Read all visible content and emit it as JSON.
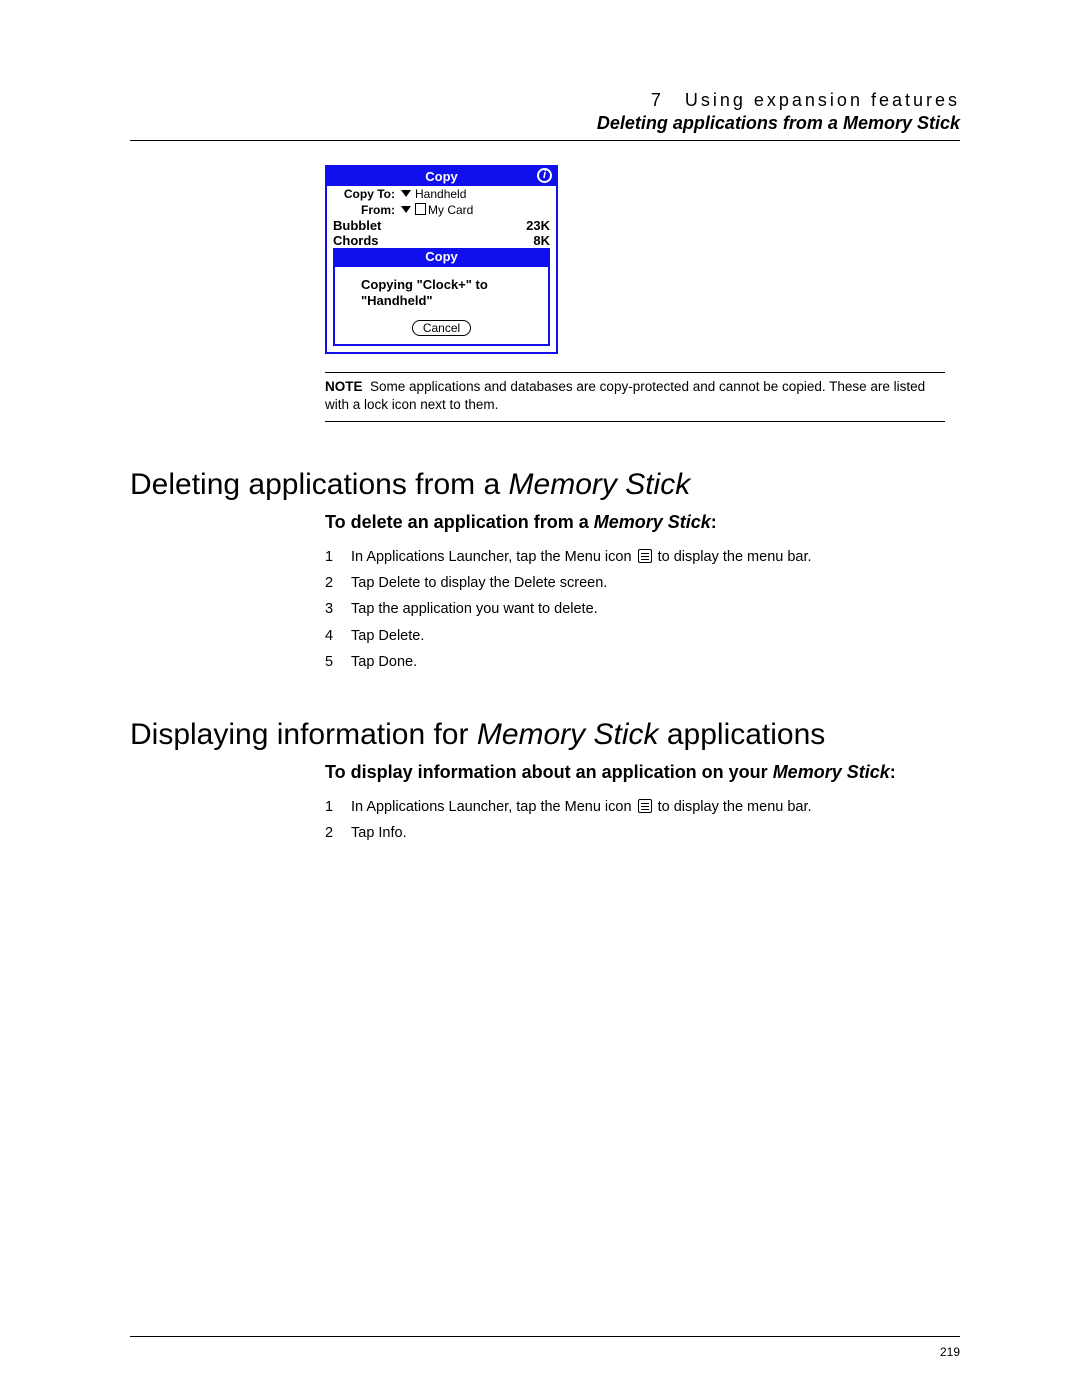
{
  "header": {
    "chapter": "7 Using expansion features",
    "subtitle": "Deleting applications from a Memory Stick"
  },
  "palm": {
    "top_title": "Copy",
    "info_glyph": "i",
    "copy_to_label": "Copy To:",
    "copy_to_value": "Handheld",
    "from_label": "From:",
    "from_value": "My Card",
    "items": [
      {
        "name": "Bubblet",
        "size": "23K"
      },
      {
        "name": "Chords",
        "size": "8K"
      }
    ],
    "dialog_title": "Copy",
    "dialog_msg_l1": "Copying \"Clock+\" to",
    "dialog_msg_l2": "\"Handheld\"",
    "cancel": "Cancel"
  },
  "note": {
    "prefix": "NOTE",
    "body": "Some applications and databases are copy-protected and cannot be copied. These are listed with a lock icon next to them."
  },
  "sec1": {
    "title_a": "Deleting applications from a ",
    "title_b": "Memory Stick",
    "sub_a": "To delete an application from a ",
    "sub_b": "Memory Stick",
    "sub_c": ":",
    "steps": [
      {
        "n": "1",
        "a": "In Applications Launcher, tap the Menu icon ",
        "b": " to display the menu bar.",
        "icon": true
      },
      {
        "n": "2",
        "a": "Tap Delete to display the Delete screen."
      },
      {
        "n": "3",
        "a": "Tap the application you want to delete."
      },
      {
        "n": "4",
        "a": "Tap Delete."
      },
      {
        "n": "5",
        "a": "Tap Done."
      }
    ]
  },
  "sec2": {
    "title_a": "Displaying information for ",
    "title_b": "Memory Stick",
    "title_c": " applications",
    "sub_a": "To display information about an application on your ",
    "sub_b": "Memory Stick",
    "sub_c": ":",
    "steps": [
      {
        "n": "1",
        "a": "In Applications Launcher, tap the Menu icon ",
        "b": " to display the menu bar.",
        "icon": true
      },
      {
        "n": "2",
        "a": "Tap Info."
      }
    ]
  },
  "page_number": "219"
}
